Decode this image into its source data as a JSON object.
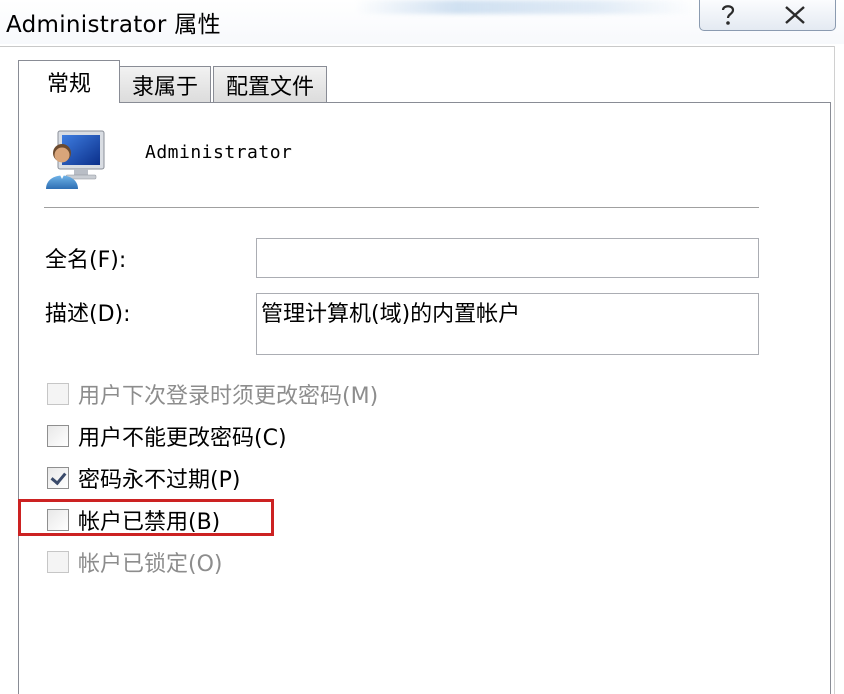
{
  "window": {
    "title": "Administrator 属性",
    "help_icon": "question-mark-icon",
    "close_icon": "close-icon"
  },
  "tabs": [
    {
      "label": "常规",
      "active": true
    },
    {
      "label": "隶属于",
      "active": false
    },
    {
      "label": "配置文件",
      "active": false
    }
  ],
  "general": {
    "user_icon": "user-account-icon",
    "user_name": "Administrator",
    "full_name": {
      "label": "全名(F):",
      "value": ""
    },
    "description": {
      "label": "描述(D):",
      "value": "管理计算机(域)的内置帐户"
    },
    "options": [
      {
        "label": "用户下次登录时须更改密码(M)",
        "checked": false,
        "enabled": false
      },
      {
        "label": "用户不能更改密码(C)",
        "checked": false,
        "enabled": true
      },
      {
        "label": "密码永不过期(P)",
        "checked": true,
        "enabled": true
      },
      {
        "label": "帐户已禁用(B)",
        "checked": false,
        "enabled": true
      },
      {
        "label": "帐户已锁定(O)",
        "checked": false,
        "enabled": false
      }
    ]
  },
  "colors": {
    "highlight_border": "#cc2222",
    "disabled_text": "#8d8d8d"
  }
}
